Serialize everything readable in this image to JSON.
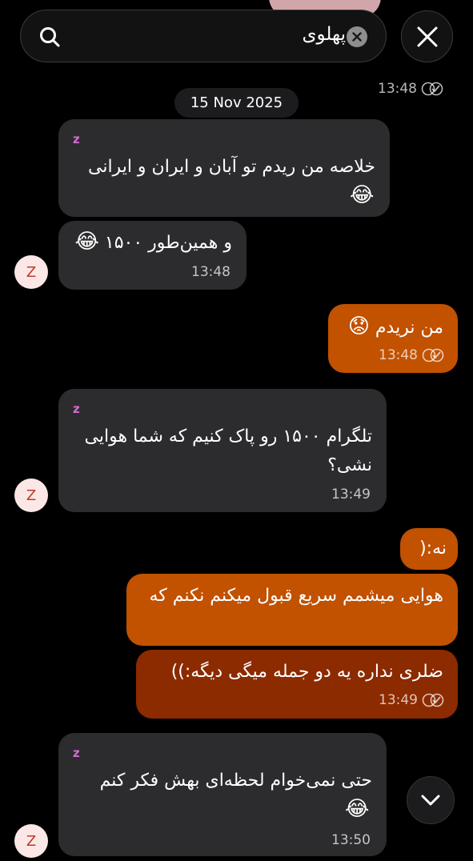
{
  "search": {
    "query": "پهلوی"
  },
  "date_separator": "15 Nov 2025",
  "top_time": "13:48",
  "messages": [
    {
      "sender": "z",
      "text": "خلاصه من ریدم تو آبان و ایران و ایرانی",
      "emoji": "😂"
    },
    {
      "text": "و همین‌طور ۱۵۰۰",
      "emoji": "😂",
      "time": "13:48"
    },
    {
      "text": "من نریدم",
      "emoji": "😟",
      "time": "13:48"
    },
    {
      "sender": "z",
      "text": "تلگرام ۱۵۰۰ رو پاک کنیم که شما هوایی نشی؟",
      "time": "13:49"
    },
    {
      "text": "نه:("
    },
    {
      "text": "هوایی میشمم سریع قبول میکنم نکنم که"
    },
    {
      "text": "ضلری نداره یه دو جمله میگی دیگه:))",
      "time": "13:49"
    },
    {
      "sender": "z",
      "text": "حتی نمی‌خوام لحظه‌ای بهش فکر کنم",
      "emoji": "😂",
      "time": "13:50"
    }
  ],
  "avatar_letter": "Z",
  "icons": [
    "search-icon",
    "clear-icon",
    "close-icon",
    "read-checks-icon",
    "chevron-down-icon"
  ],
  "colors": {
    "incoming": "#2c2c2e",
    "outgoing": "#c25100",
    "outgoing_dark": "#8c2a00",
    "sender": "#d26bd3"
  }
}
